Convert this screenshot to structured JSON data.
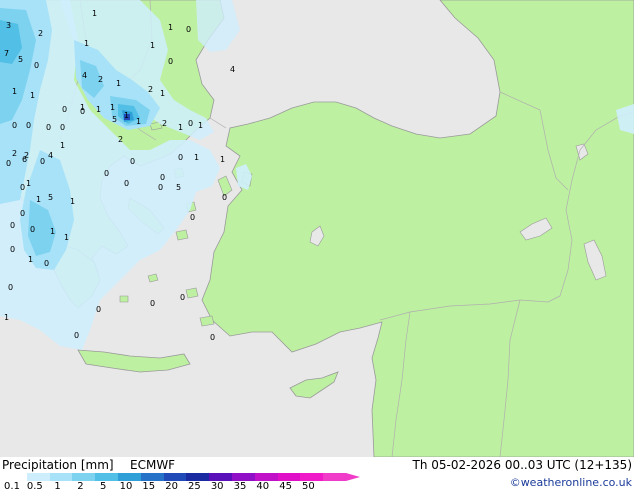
{
  "map": {
    "colors": {
      "sea": "#e8e8e8",
      "land": "#bdf0a0",
      "border": "#b0b0b0",
      "coast": "#9a9a9a"
    },
    "point_values": [
      "3",
      "1",
      "2",
      "7",
      "5",
      "0",
      "1",
      "0",
      "1",
      "1",
      "1",
      "1",
      "0",
      "0",
      "0",
      "1",
      "0",
      "4",
      "2",
      "1",
      "2",
      "1",
      "5",
      "1",
      "1",
      "1",
      "2",
      "1",
      "0",
      "1",
      "0",
      "0",
      "1",
      "1",
      "2",
      "2",
      "0",
      "2",
      "0",
      "1",
      "1",
      "6",
      "4",
      "0",
      "1",
      "5",
      "1",
      "1",
      "0",
      "0",
      "0",
      "1",
      "0",
      "1",
      "0",
      "0",
      "5",
      "4",
      "0",
      "0",
      "1",
      "0",
      "1",
      "0",
      "0",
      "0",
      "0",
      "0",
      "0",
      "0",
      "0",
      "0",
      "0",
      "0"
    ]
  },
  "footer": {
    "title": "Precipitation [mm]",
    "model": "ECMWF",
    "datetime": "Th 05-02-2026 00..03 UTC (12+135)",
    "copyright": "©weatheronline.co.uk",
    "scale_labels": [
      "0.1",
      "0.5",
      "1",
      "2",
      "5",
      "10",
      "15",
      "20",
      "25",
      "30",
      "35",
      "40",
      "45",
      "50"
    ],
    "scale_colors": [
      "#ffffff",
      "#cfeefd",
      "#a8e2f8",
      "#7dd2f0",
      "#52bfe6",
      "#2f9fd8",
      "#2572c8",
      "#1f4ab8",
      "#1a2aa0",
      "#5a10b8",
      "#9010c8",
      "#c010c8",
      "#e010c8",
      "#f01ac8",
      "#f03cc8"
    ]
  }
}
